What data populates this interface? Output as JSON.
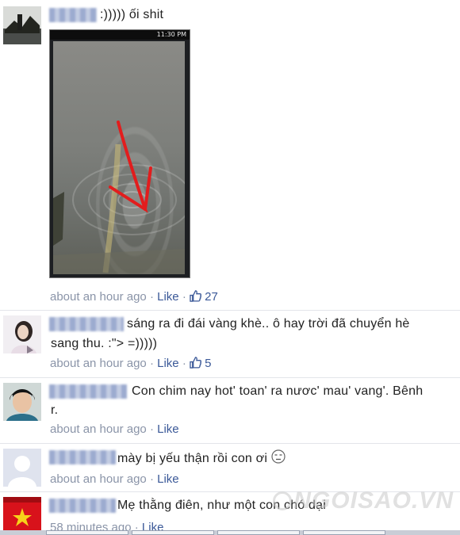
{
  "comments": [
    {
      "text": ":))))) ối shit",
      "time": "about an hour ago",
      "like_label": "Like",
      "separator": "·",
      "likes": "27",
      "has_attachment": true
    },
    {
      "text": "sáng ra đi đái vàng khè.. ô hay trời đã chuyển hè",
      "text2": "sang thu. :\"> =)))))",
      "time": "about an hour ago",
      "like_label": "Like",
      "separator": "·",
      "likes": "5"
    },
    {
      "text": "Con chim nay hot' toan' ra nươc' mau' vang'. Bênh",
      "text2": "r.",
      "time": "about an hour ago",
      "like_label": "Like",
      "separator": "·"
    },
    {
      "text": "mày bị yếu thận rồi con ơi",
      "time": "about an hour ago",
      "like_label": "Like",
      "separator": "·"
    },
    {
      "text": "Mẹ thằng điên, như một con chó dại",
      "time": "58 minutes ago",
      "like_label": "Like",
      "separator": "·"
    }
  ],
  "phone_status": "11:30 PM",
  "watermark": "NGOISAO.VN",
  "colors": {
    "link": "#3b5998",
    "meta": "#8a94a8",
    "separator": "#e3e5ea"
  }
}
